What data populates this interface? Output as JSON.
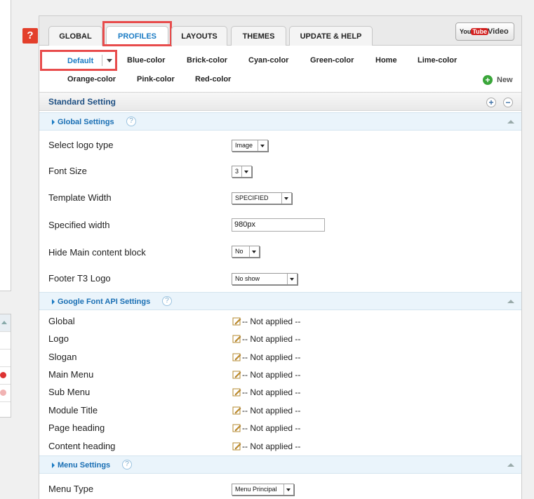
{
  "tabs": [
    {
      "label": "GLOBAL"
    },
    {
      "label": "PROFILES"
    },
    {
      "label": "LAYOUTS"
    },
    {
      "label": "THEMES"
    },
    {
      "label": "UPDATE & HELP"
    }
  ],
  "video_button": {
    "logo_you": "You",
    "logo_tube": "Tube",
    "label": "Video"
  },
  "profiles": {
    "selected": "Default",
    "items": [
      "Blue-color",
      "Brick-color",
      "Cyan-color",
      "Green-color",
      "Home",
      "Lime-color",
      "Orange-color",
      "Pink-color",
      "Red-color"
    ],
    "new_label": "New"
  },
  "help_button": "?",
  "standard": {
    "title": "Standard Setting",
    "expand": "+",
    "collapse": "−"
  },
  "global_settings": {
    "title": "Global Settings",
    "help": "?",
    "rows": [
      {
        "label": "Select logo type",
        "value": "Image"
      },
      {
        "label": "Font Size",
        "value": "3"
      },
      {
        "label": "Template Width",
        "value": "SPECIFIED"
      },
      {
        "label": "Specified width",
        "value": "980px"
      },
      {
        "label": "Hide Main content block",
        "value": "No"
      },
      {
        "label": "Footer T3 Logo",
        "value": "No show"
      }
    ]
  },
  "font_settings": {
    "title": "Google Font API Settings",
    "help": "?",
    "rows": [
      {
        "label": "Global",
        "value": "-- Not applied --"
      },
      {
        "label": "Logo",
        "value": "-- Not applied --"
      },
      {
        "label": "Slogan",
        "value": "-- Not applied --"
      },
      {
        "label": "Main Menu",
        "value": "-- Not applied --"
      },
      {
        "label": "Sub Menu",
        "value": "-- Not applied --"
      },
      {
        "label": "Module Title",
        "value": "-- Not applied --"
      },
      {
        "label": "Page heading",
        "value": "-- Not applied --"
      },
      {
        "label": "Content heading",
        "value": "-- Not applied --"
      }
    ]
  },
  "menu_settings": {
    "title": "Menu Settings",
    "help": "?",
    "rows": [
      {
        "label": "Menu Type",
        "value": "Menu Principal"
      }
    ]
  }
}
